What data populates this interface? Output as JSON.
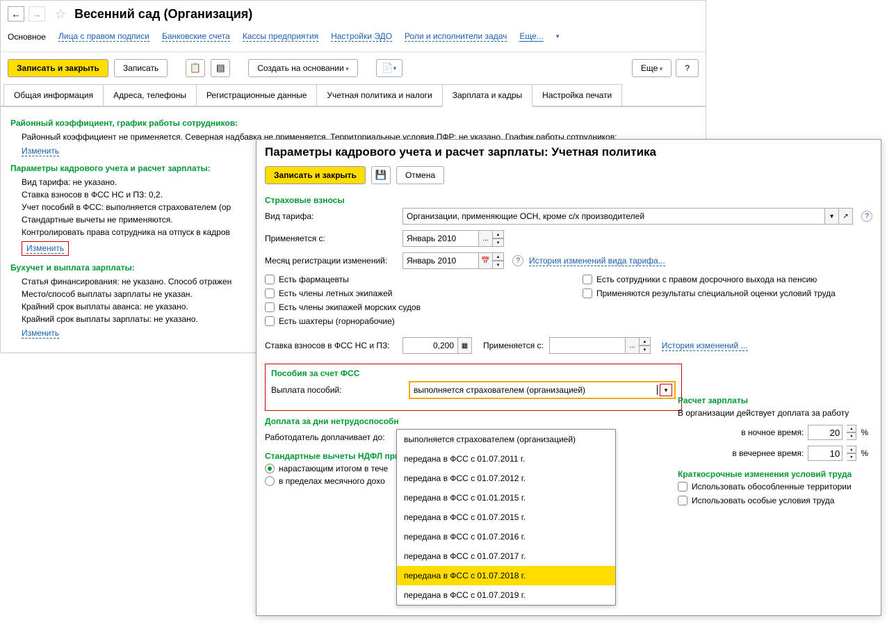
{
  "mainTitle": "Весенний сад (Организация)",
  "navLinks": {
    "current": "Основное",
    "items": [
      "Лица с правом подписи",
      "Банковские счета",
      "Кассы предприятия",
      "Настройки ЭДО",
      "Роли и исполнители задач"
    ],
    "more": "Еще..."
  },
  "toolbar": {
    "saveClose": "Записать и закрыть",
    "save": "Записать",
    "createBased": "Создать на основании",
    "more": "Еще",
    "help": "?"
  },
  "tabs": [
    "Общая информация",
    "Адреса, телефоны",
    "Регистрационные данные",
    "Учетная политика и налоги",
    "Зарплата и кадры",
    "Настройка печати"
  ],
  "sections": {
    "s1": {
      "title": "Районный коэффициент, график работы сотрудников:",
      "body": "Районный коэффициент не применяется. Северная надбавка не применяется. Территориальные условия ПФР: не указано. График работы сотрудников:",
      "change": "Изменить"
    },
    "s2": {
      "title": "Параметры кадрового учета и расчет зарплаты:",
      "lines": [
        "Вид тарифа: не указано.",
        "Ставка взносов в ФСС НС и ПЗ: 0,2.",
        "Учет пособий в ФСС: выполняется страхователем (ор",
        "Стандартные вычеты не применяются.",
        "Контролировать права сотрудника на отпуск в кадров"
      ],
      "change": "Изменить"
    },
    "s3": {
      "title": "Бухучет и выплата зарплаты:",
      "lines": [
        "Статья финансирования: не указано. Способ отражен",
        "Место/способ выплаты зарплаты не указан.",
        "Крайний срок выплаты аванса: не указано.",
        "Крайний срок выплаты зарплаты: не указано."
      ],
      "change": "Изменить"
    }
  },
  "dialog": {
    "title": "Параметры кадрового учета и расчет зарплаты: Учетная политика",
    "saveClose": "Записать и закрыть",
    "cancel": "Отмена",
    "insurance": {
      "heading": "Страховые взносы",
      "tariffLabel": "Вид тарифа:",
      "tariffValue": "Организации, применяющие ОСН, кроме с/х производителей",
      "appliedFromLabel": "Применяется с:",
      "appliedFromValue": "Январь 2010",
      "regMonthLabel": "Месяц регистрации изменений:",
      "regMonthValue": "Январь 2010",
      "historyLink": "История изменений вида тарифа...",
      "checks": {
        "pharmacists": "Есть фармацевты",
        "flightCrew": "Есть члены летных экипажей",
        "seaCrew": "Есть члены экипажей морских судов",
        "miners": "Есть шахтеры (горнорабочие)",
        "earlyPension": "Есть сотрудники с правом досрочного выхода на пенсию",
        "specialEval": "Применяются результаты специальной оценки условий труда"
      },
      "rateLabel": "Ставка взносов в ФСС НС и ПЗ:",
      "rateValue": "0,200",
      "appliedFrom2Label": "Применяется с:",
      "historyLink2": "История изменений ..."
    },
    "fss": {
      "heading": "Пособия за счет ФСС",
      "payLabel": "Выплата пособий:",
      "payValue": "выполняется страхователем (организацией)",
      "options": [
        "выполняется страхователем (организацией)",
        "передана в ФСС с 01.07.2011 г.",
        "передана в ФСС с 01.07.2012 г.",
        "передана в ФСС с 01.01.2015 г.",
        "передана в ФСС с 01.07.2015 г.",
        "передана в ФСС с 01.07.2016 г.",
        "передана в ФСС с 01.07.2017 г.",
        "передана в ФСС с 01.07.2018 г.",
        "передана в ФСС с 01.07.2019 г."
      ]
    },
    "disability": {
      "heading": "Доплата за дни нетрудоспособн",
      "label": "Работодатель доплачивает до:"
    },
    "deductions": {
      "heading": "Стандартные вычеты НДФЛ при",
      "opt1": "нарастающим итогом в тече",
      "opt2": "в пределах месячного дохо"
    },
    "salary": {
      "heading": "Расчет зарплаты",
      "overtime": "В организации действует доплата за работу",
      "night": "в ночное время:",
      "nightVal": "20",
      "evening": "в вечернее время:",
      "eveningVal": "10",
      "percent": "%",
      "shortTerm": "Краткосрочные изменения условий труда",
      "territories": "Использовать обособленные территории",
      "conditions": "Использовать особые условия труда"
    }
  }
}
